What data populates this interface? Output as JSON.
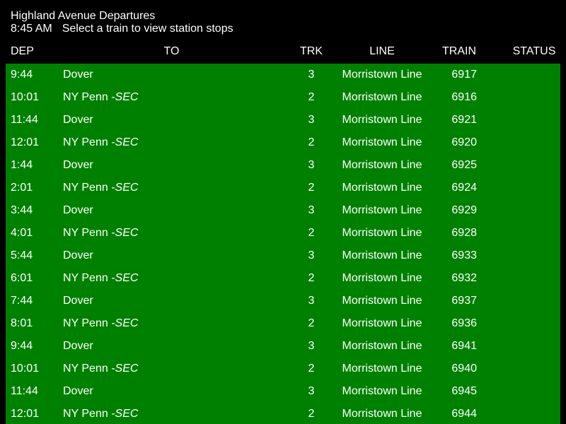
{
  "header": {
    "title": "Highland Avenue Departures",
    "time": "8:45 AM",
    "instruction": "Select a train to view station stops"
  },
  "columns": {
    "dep": "DEP",
    "to": "TO",
    "trk": "TRK",
    "line": "LINE",
    "train": "TRAIN",
    "status": "STATUS"
  },
  "colors": {
    "background": "#000000",
    "board": "#008000",
    "text": "#ffffff"
  },
  "departures": [
    {
      "dep": "9:44",
      "to": "Dover",
      "note": "",
      "trk": "3",
      "line": "Morristown Line",
      "train": "6917",
      "status": ""
    },
    {
      "dep": "10:01",
      "to": "NY Penn",
      "note": " -SEC",
      "trk": "2",
      "line": "Morristown Line",
      "train": "6916",
      "status": ""
    },
    {
      "dep": "11:44",
      "to": "Dover",
      "note": "",
      "trk": "3",
      "line": "Morristown Line",
      "train": "6921",
      "status": ""
    },
    {
      "dep": "12:01",
      "to": "NY Penn",
      "note": " -SEC",
      "trk": "2",
      "line": "Morristown Line",
      "train": "6920",
      "status": ""
    },
    {
      "dep": "1:44",
      "to": "Dover",
      "note": "",
      "trk": "3",
      "line": "Morristown Line",
      "train": "6925",
      "status": ""
    },
    {
      "dep": "2:01",
      "to": "NY Penn",
      "note": " -SEC",
      "trk": "2",
      "line": "Morristown Line",
      "train": "6924",
      "status": ""
    },
    {
      "dep": "3:44",
      "to": "Dover",
      "note": "",
      "trk": "3",
      "line": "Morristown Line",
      "train": "6929",
      "status": ""
    },
    {
      "dep": "4:01",
      "to": "NY Penn",
      "note": " -SEC",
      "trk": "2",
      "line": "Morristown Line",
      "train": "6928",
      "status": ""
    },
    {
      "dep": "5:44",
      "to": "Dover",
      "note": "",
      "trk": "3",
      "line": "Morristown Line",
      "train": "6933",
      "status": ""
    },
    {
      "dep": "6:01",
      "to": "NY Penn",
      "note": " -SEC",
      "trk": "2",
      "line": "Morristown Line",
      "train": "6932",
      "status": ""
    },
    {
      "dep": "7:44",
      "to": "Dover",
      "note": "",
      "trk": "3",
      "line": "Morristown Line",
      "train": "6937",
      "status": ""
    },
    {
      "dep": "8:01",
      "to": "NY Penn",
      "note": " -SEC",
      "trk": "2",
      "line": "Morristown Line",
      "train": "6936",
      "status": ""
    },
    {
      "dep": "9:44",
      "to": "Dover",
      "note": "",
      "trk": "3",
      "line": "Morristown Line",
      "train": "6941",
      "status": ""
    },
    {
      "dep": "10:01",
      "to": "NY Penn",
      "note": " -SEC",
      "trk": "2",
      "line": "Morristown Line",
      "train": "6940",
      "status": ""
    },
    {
      "dep": "11:44",
      "to": "Dover",
      "note": "",
      "trk": "3",
      "line": "Morristown Line",
      "train": "6945",
      "status": ""
    },
    {
      "dep": "12:01",
      "to": "NY Penn",
      "note": " -SEC",
      "trk": "2",
      "line": "Morristown Line",
      "train": "6944",
      "status": ""
    }
  ]
}
